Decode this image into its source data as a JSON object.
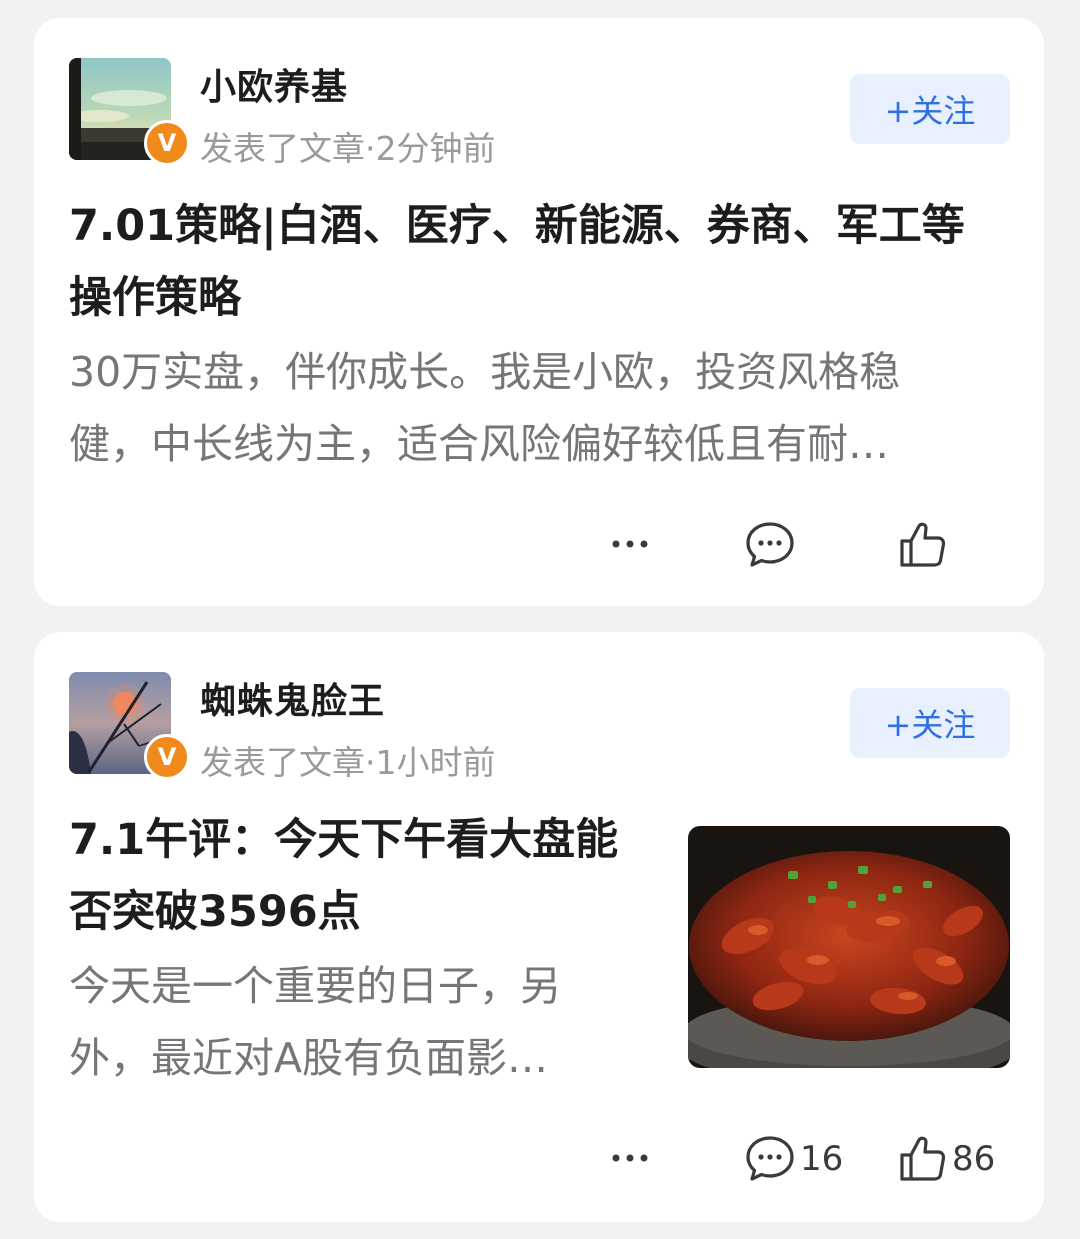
{
  "posts": [
    {
      "author": "小欧养基",
      "verified_badge": "V",
      "meta": "发表了文章·2分钟前",
      "follow_label": "+关注",
      "title_lines": [
        "7.01策略|白酒、医疗、新能源、券商、军工等",
        "操作策略"
      ],
      "summary_lines": [
        "30万实盘，伴你成长。我是小欧，投资风格稳",
        "健，中长线为主，适合风险偏好较低且有耐…"
      ],
      "more_label": "···",
      "comment_count": "",
      "like_count": "",
      "avatar_icon": "sky-landscape-photo",
      "has_thumbnail": false
    },
    {
      "author": "蜘蛛鬼脸王",
      "verified_badge": "V",
      "meta": "发表了文章·1小时前",
      "follow_label": "+关注",
      "title_lines": [
        "7.1午评：今天下午看大盘能",
        "否突破3596点"
      ],
      "summary_lines": [
        "今天是一个重要的日子，另",
        "外，最近对A股有负面影…"
      ],
      "more_label": "···",
      "comment_count": "16",
      "like_count": "86",
      "avatar_icon": "sunset-branch-photo",
      "has_thumbnail": true,
      "thumbnail_icon": "crayfish-dish-photo"
    }
  ],
  "colors": {
    "background": "#f2f2f4",
    "card": "#ffffff",
    "follow_bg": "#e8f0fd",
    "follow_text": "#2f6fe6",
    "badge": "#f08a1c",
    "title": "#1d1d1f",
    "summary": "#76767a",
    "meta": "#9a9a9e"
  }
}
